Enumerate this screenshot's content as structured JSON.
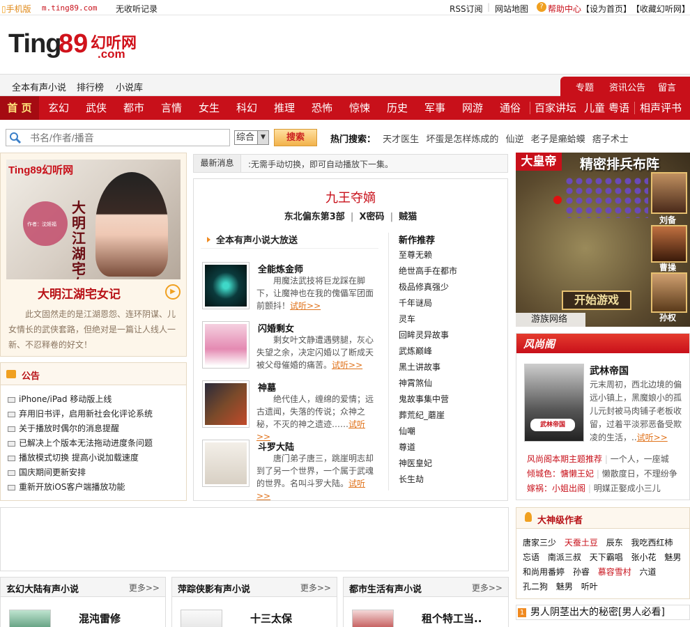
{
  "topbar": {
    "mobile": "手机版",
    "mobile_url": "m.ting89.com",
    "history": "无收听记录",
    "rss": "RSS订阅",
    "sitemap": "网站地图",
    "help": "帮助中心",
    "sethome": "【设为首页】",
    "favorite": "【收藏幻听网】"
  },
  "logo": {
    "ting": "Ting",
    "num": "89",
    "cn": "幻听网",
    "dotcom": ".com"
  },
  "subnav": {
    "left": [
      "全本有声小说",
      "排行榜",
      "小说库"
    ],
    "right": [
      "专题",
      "资讯公告",
      "留言"
    ]
  },
  "mainnav": {
    "home": "首 页",
    "items": [
      "玄幻",
      "武侠",
      "都市",
      "言情",
      "女生",
      "科幻",
      "推理",
      "恐怖",
      "惊悚",
      "历史",
      "军事",
      "网游",
      "通俗",
      "百家讲坛",
      "儿童",
      "粤语",
      "相声评书"
    ]
  },
  "search": {
    "placeholder": "书名/作者/播音",
    "select": "综合",
    "button": "搜索",
    "hot_label": "热门搜索：",
    "hot": [
      "天才医生",
      "坏蛋是怎样炼成的",
      "仙逆",
      "老子是癞蛤蟆",
      "痞子术士"
    ]
  },
  "left": {
    "cover_logo": "Ting89幻听网",
    "cover_author": "作者：沈姬福",
    "cover_title": "大明江湖宅女记",
    "title": "大明江湖宅女记",
    "desc": "此文固然走的是江湖恩怨、连环阴谋、儿女情长的武侠套路，但绝对是一篇让人线人一新、不忍释卷的好文！",
    "notice_title": "公告",
    "notices": [
      "iPhone/iPad 移动版上线",
      "弃用旧书评，启用新社会化评论系统",
      "关于播放时偶尔的消息提醒",
      "已解决上个版本无法拖动进度条问题",
      "播放模式切换 提高小说加载速度",
      "国庆期间更新安排",
      "重新开放iOS客户端播放功能"
    ]
  },
  "middle": {
    "news_label": "最新消息",
    "news_text": ":无需手动切换，即可自动播放下一集。",
    "title": "九王夺嫡",
    "sub": [
      "东北偏东第3部",
      "X密码",
      "贼猫"
    ],
    "section": "全本有声小说大放送",
    "books": [
      {
        "name": "全能炼金师",
        "desc": "用魔法武技将巨龙踩在脚下，让魔神也在我的傀儡军团面前颤抖！",
        "more": "试听>>"
      },
      {
        "name": "闪婚剩女",
        "desc": "剩女叶文静遭遇劈腿，灰心失望之余，决定闪婚以了断成天被父母催婚的痛苦。",
        "more": "试听>>"
      },
      {
        "name": "神墓",
        "desc": "绝代佳人，缠绵的爱情；远古遗闻，失落的传说；众神之秘，不灭的神之遗迹……",
        "more": "试听>>"
      },
      {
        "name": "斗罗大陆",
        "desc": "唐门弟子唐三，跳崖明志却到了另一个世界，一个属于武魂的世界。名叫斗罗大陆。",
        "more": "试听>>"
      }
    ],
    "new_title": "新作推荐",
    "new_list": [
      "至尊无赖",
      "绝世高手在都市",
      "极品修真强少",
      "千年谜局",
      "灵车",
      "回眸灵异故事",
      "武炼巅峰",
      "黑土讲故事",
      "神霄煞仙",
      "鬼故事集中营",
      "葬荒纪_蘑崖",
      "仙嘲",
      "尊道",
      "神医皇妃",
      "长生劫"
    ]
  },
  "ad": {
    "brand": "大皇帝",
    "headline": "精密排兵布阵",
    "start": "开始游戏",
    "footer": "游族网络",
    "generals": [
      "刘备",
      "曹操",
      "孙权"
    ]
  },
  "fsg": {
    "header": "风尚阁",
    "cover_text": "武林帝国",
    "name": "武林帝国",
    "desc": "元末周初，西北边境的偏远小镇上，黑魔娘小的孤儿元封被马肉铺子老板收留，过着平淡邪恶备受欺凌的生活，..",
    "more": "试听>>",
    "lines": [
      {
        "red": "风尚阁本期主题推荐",
        "sep": "|",
        "rest": "一个人，一座城"
      },
      {
        "red": "倾城色：慵懒王妃",
        "sep": "|",
        "rest": "懒散度日，不理纷争"
      },
      {
        "red": "嫁祸：小姐出阁",
        "sep": "|",
        "rest": "明媒正娶成小三儿"
      }
    ]
  },
  "authors": {
    "title": "大神级作者",
    "list": [
      {
        "n": "唐家三少",
        "r": false
      },
      {
        "n": "天蚕土豆",
        "r": true
      },
      {
        "n": "辰东",
        "r": false
      },
      {
        "n": "我吃西红柿",
        "r": false
      },
      {
        "n": "忘语",
        "r": false
      },
      {
        "n": "南派三叔",
        "r": false
      },
      {
        "n": "天下霸唱",
        "r": false
      },
      {
        "n": "张小花",
        "r": false
      },
      {
        "n": "魅男",
        "r": false
      },
      {
        "n": "和尚用番婷",
        "r": false
      },
      {
        "n": "孙睿",
        "r": false
      },
      {
        "n": "慕容雪村",
        "r": true
      },
      {
        "n": "六道",
        "r": false
      },
      {
        "n": "孔二狗",
        "r": false
      },
      {
        "n": "魅男",
        "r": false
      },
      {
        "n": "听叶",
        "r": false
      }
    ]
  },
  "rank": {
    "num": "1",
    "text": "男人阴茎出大的秘密[男人必看]"
  },
  "bottom": [
    {
      "title": "玄幻大陆有声小说",
      "more": "更多>>",
      "book": "混沌雷修"
    },
    {
      "title": "萍踪侠影有声小说",
      "more": "更多>>",
      "book": "十三太保"
    },
    {
      "title": "都市生活有声小说",
      "more": "更多>>",
      "book": "租个特工当.."
    }
  ],
  "colors": {
    "brand_red": "#c8101a",
    "accent_orange": "#f0a020",
    "link_orange": "#e0721a"
  }
}
